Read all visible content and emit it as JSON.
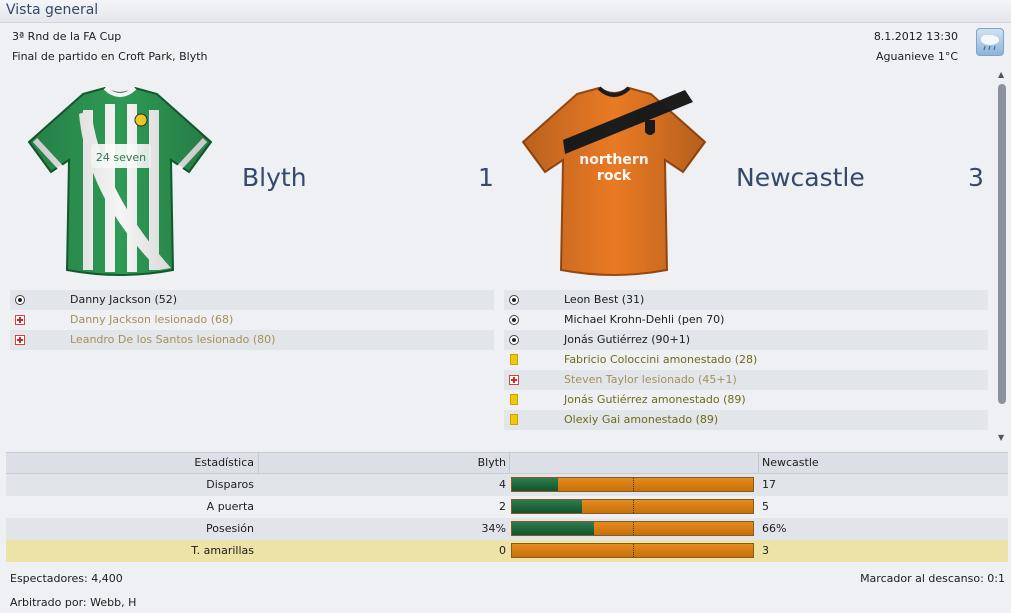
{
  "header": {
    "title": "Vista general"
  },
  "match": {
    "competition": "3ª Rnd de la FA Cup",
    "result_line": "Final de partido en Croft Park, Blyth",
    "datetime": "8.1.2012 13:30",
    "weather": "Aguanieve 1°C",
    "weather_icon": "sleet-icon"
  },
  "home": {
    "name": "Blyth",
    "score": "1",
    "kit_colors": {
      "primary": "#2f9a55",
      "secondary": "#ffffff"
    },
    "events": [
      {
        "type": "goal",
        "text": "Danny Jackson (52)"
      },
      {
        "type": "injury",
        "text": "Danny Jackson lesionado (68)"
      },
      {
        "type": "injury",
        "text": "Leandro De los Santos lesionado (80)"
      }
    ]
  },
  "away": {
    "name": "Newcastle",
    "score": "3",
    "kit_colors": {
      "primary": "#e87a26",
      "secondary": "#1a1a1a"
    },
    "kit_sponsor": "northern rock",
    "events": [
      {
        "type": "goal",
        "text": "Leon Best (31)"
      },
      {
        "type": "goal",
        "text": "Michael Krohn-Dehli (pen 70)"
      },
      {
        "type": "goal",
        "text": "Jonás Gutiérrez (90+1)"
      },
      {
        "type": "yellow",
        "text": "Fabricio Coloccini amonestado (28)"
      },
      {
        "type": "injury",
        "text": "Steven Taylor lesionado (45+1)"
      },
      {
        "type": "yellow",
        "text": "Jonás Gutiérrez amonestado (89)"
      },
      {
        "type": "yellow",
        "text": "Olexiy Gai amonestado (89)"
      }
    ]
  },
  "stats": {
    "header": {
      "label": "Estadística",
      "home": "Blyth",
      "away": "Newcastle"
    },
    "rows": [
      {
        "label": "Disparos",
        "home": "4",
        "away": "17",
        "home_share": 0.19
      },
      {
        "label": "A puerta",
        "home": "2",
        "away": "5",
        "home_share": 0.29
      },
      {
        "label": "Posesión",
        "home": "34%",
        "away": "66%",
        "home_share": 0.34
      },
      {
        "label": "T. amarillas",
        "home": "0",
        "away": "3",
        "home_share": 0.0
      }
    ]
  },
  "footer": {
    "attendance": "Espectadores: 4,400",
    "referee": "Arbitrado por: Webb, H",
    "halftime": "Marcador al descanso: 0:1"
  },
  "colors": {
    "accent": "#34496b",
    "bar_home": "#1f6a3b",
    "bar_away": "#d97c12",
    "highlight_row": "#ede3a6"
  }
}
